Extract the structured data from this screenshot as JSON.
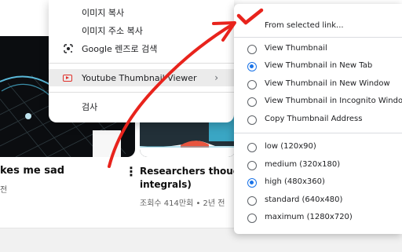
{
  "context_menu": {
    "items": [
      {
        "label": "이미지 복사"
      },
      {
        "label": "이미지 주소 복사"
      },
      {
        "label": "Google 렌즈로 검색",
        "icon": "lens-icon"
      },
      {
        "label": "Youtube Thumbnail Viewer",
        "icon": "youtube-icon",
        "highlighted": true
      },
      {
        "label": "검사"
      }
    ]
  },
  "submenu": {
    "header": "From selected link...",
    "actions": [
      {
        "label": "View Thumbnail",
        "checked": false
      },
      {
        "label": "View Thumbnail in New Tab",
        "checked": true
      },
      {
        "label": "View Thumbnail in New Window",
        "checked": false
      },
      {
        "label": "View Thumbnail in Incognito Window",
        "checked": false
      },
      {
        "label": "Copy Thumbnail Address",
        "checked": false
      }
    ],
    "sizes": [
      {
        "label": "low (120x90)",
        "checked": false
      },
      {
        "label": "medium (320x180)",
        "checked": false
      },
      {
        "label": "high (480x360)",
        "checked": true
      },
      {
        "label": "standard (640x480)",
        "checked": false
      },
      {
        "label": "maximum (1280x720)",
        "checked": false
      }
    ]
  },
  "feed": {
    "left_video": {
      "title": "kes me sad",
      "meta": "전"
    },
    "right_video": {
      "title_line1": "Researchers thought thi",
      "title_line2": "integrals)",
      "meta": "조회수 414만회 • 2년 전"
    }
  },
  "colors": {
    "annotation": "#e8231c",
    "radio_checked": "#1a73e8"
  }
}
